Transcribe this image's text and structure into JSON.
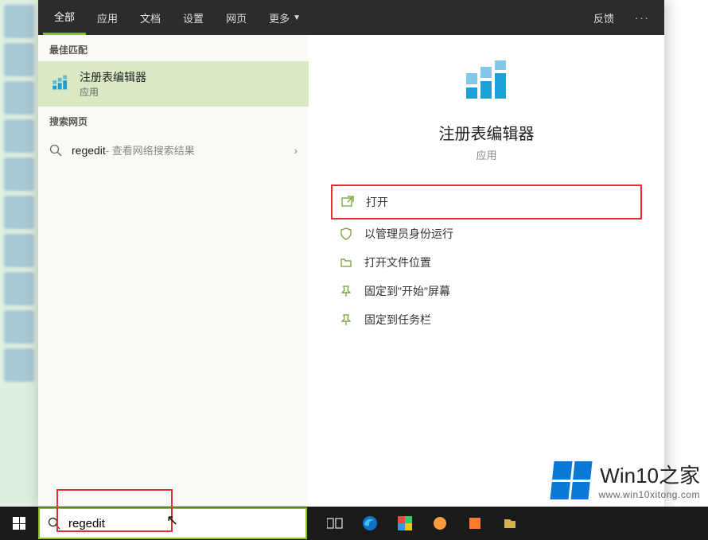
{
  "tabs": {
    "all": "全部",
    "apps": "应用",
    "docs": "文档",
    "settings": "设置",
    "web": "网页",
    "more": "更多"
  },
  "feedback": "反馈",
  "sections": {
    "best_match": "最佳匹配",
    "search_web": "搜索网页"
  },
  "best_match": {
    "title": "注册表编辑器",
    "subtitle": "应用"
  },
  "web_result": {
    "term": "regedit",
    "hint": " - 查看网络搜索结果"
  },
  "detail": {
    "title": "注册表编辑器",
    "subtitle": "应用",
    "actions": {
      "open": "打开",
      "run_admin": "以管理员身份运行",
      "open_location": "打开文件位置",
      "pin_start": "固定到\"开始\"屏幕",
      "pin_taskbar": "固定到任务栏"
    }
  },
  "search_input": {
    "value": "regedit"
  },
  "watermark": {
    "brand": "Win10之家",
    "url": "www.win10xitong.com"
  },
  "colors": {
    "accent": "#84c225",
    "highlight_bg": "#dbe8c4",
    "annot": "#e03030",
    "win_blue": "#0a78d6"
  }
}
